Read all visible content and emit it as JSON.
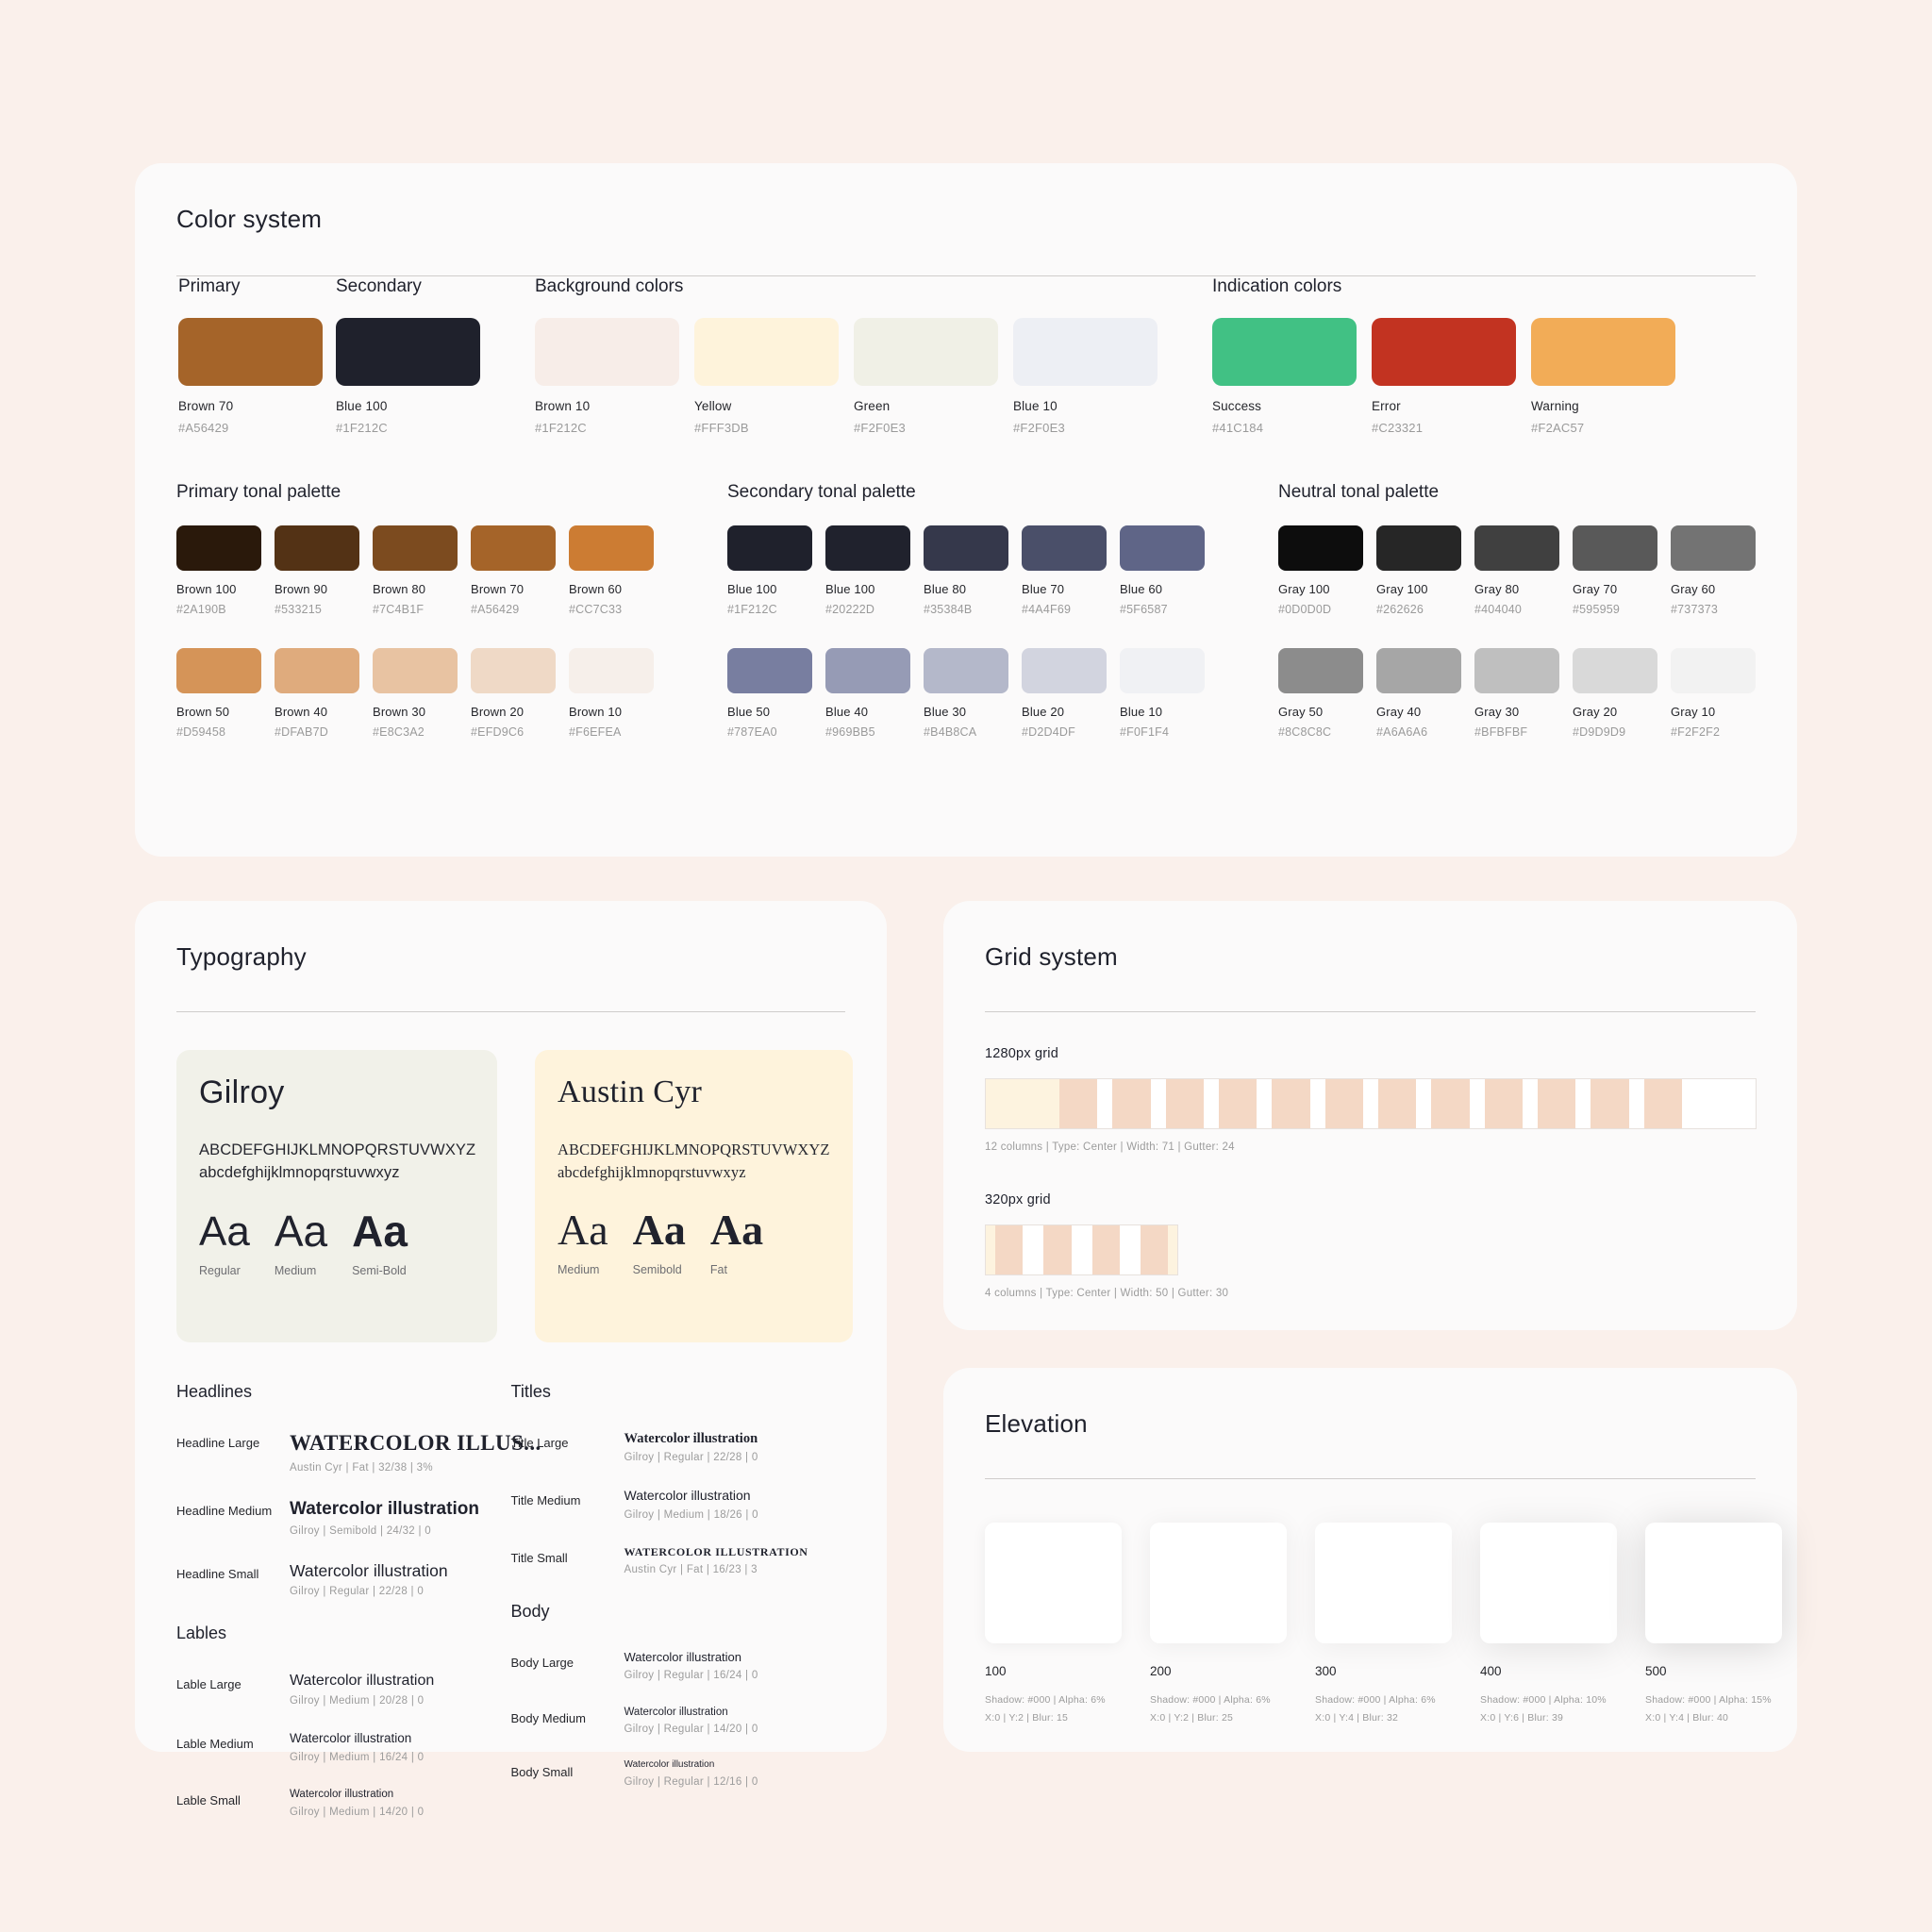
{
  "page": {
    "background": "#FAF0EB"
  },
  "color_system": {
    "title": "Color system",
    "groups": [
      {
        "label": "Primary",
        "swatches": [
          {
            "name": "Brown 70",
            "hex": "#A56429"
          }
        ]
      },
      {
        "label": "Secondary",
        "swatches": [
          {
            "name": "Blue 100",
            "hex": "#1F212C"
          }
        ]
      },
      {
        "label": "Background colors",
        "swatches": [
          {
            "name": "Brown 10",
            "hex": "#1F212C",
            "fill": "#F7EDE8"
          },
          {
            "name": "Yellow",
            "hex": "#FFF3DB",
            "fill": "#FEF3DB"
          },
          {
            "name": "Green",
            "hex": "#F2F0E3",
            "fill": "#F0F0E6"
          },
          {
            "name": "Blue 10",
            "hex": "#F2F0E3",
            "fill": "#EDEFF4"
          }
        ]
      },
      {
        "label": "Indication colors",
        "swatches": [
          {
            "name": "Success",
            "hex": "#41C184"
          },
          {
            "name": "Error",
            "hex": "#C23321"
          },
          {
            "name": "Warning",
            "hex": "#F2AC57"
          }
        ]
      }
    ],
    "tonal_palettes": [
      {
        "title": "Primary tonal palette",
        "rows": [
          [
            {
              "name": "Brown 100",
              "hex": "#2A190B"
            },
            {
              "name": "Brown 90",
              "hex": "#533215"
            },
            {
              "name": "Brown 80",
              "hex": "#7C4B1F"
            },
            {
              "name": "Brown 70",
              "hex": "#A56429"
            },
            {
              "name": "Brown 60",
              "hex": "#CC7C33"
            }
          ],
          [
            {
              "name": "Brown 50",
              "hex": "#D59458"
            },
            {
              "name": "Brown 40",
              "hex": "#DFAB7D"
            },
            {
              "name": "Brown 30",
              "hex": "#E8C3A2"
            },
            {
              "name": "Brown 20",
              "hex": "#EFD9C6"
            },
            {
              "name": "Brown 10",
              "hex": "#F6EFEA"
            }
          ]
        ]
      },
      {
        "title": "Secondary tonal palette",
        "rows": [
          [
            {
              "name": "Blue 100",
              "hex": "#1F212C"
            },
            {
              "name": "Blue 100",
              "hex": "#20222D"
            },
            {
              "name": "Blue 80",
              "hex": "#35384B"
            },
            {
              "name": "Blue 70",
              "hex": "#4A4F69"
            },
            {
              "name": "Blue 60",
              "hex": "#5F6587"
            }
          ],
          [
            {
              "name": "Blue 50",
              "hex": "#787EA0"
            },
            {
              "name": "Blue 40",
              "hex": "#969BB5"
            },
            {
              "name": "Blue 30",
              "hex": "#B4B8CA"
            },
            {
              "name": "Blue 20",
              "hex": "#D2D4DF"
            },
            {
              "name": "Blue 10",
              "hex": "#F0F1F4"
            }
          ]
        ]
      },
      {
        "title": "Neutral tonal palette",
        "rows": [
          [
            {
              "name": "Gray 100",
              "hex": "#0D0D0D"
            },
            {
              "name": "Gray 100",
              "hex": "#262626"
            },
            {
              "name": "Gray 80",
              "hex": "#404040"
            },
            {
              "name": "Gray 70",
              "hex": "#595959"
            },
            {
              "name": "Gray 60",
              "hex": "#737373"
            }
          ],
          [
            {
              "name": "Gray 50",
              "hex": "#8C8C8C"
            },
            {
              "name": "Gray 40",
              "hex": "#A6A6A6"
            },
            {
              "name": "Gray 30",
              "hex": "#BFBFBF"
            },
            {
              "name": "Gray 20",
              "hex": "#D9D9D9"
            },
            {
              "name": "Gray 10",
              "hex": "#F2F2F2"
            }
          ]
        ]
      }
    ]
  },
  "typography": {
    "title": "Typography",
    "specimens": [
      {
        "family": "Gilroy",
        "uppercase": "ABCDEFGHIJKLMNOPQRSTUVWXYZ",
        "lowercase": "abcdefghijklmnopqrstuvwxyz",
        "weights": [
          {
            "glyph": "Aa",
            "name": "Regular"
          },
          {
            "glyph": "Aa",
            "name": "Medium"
          },
          {
            "glyph": "Aa",
            "name": "Semi-Bold"
          }
        ]
      },
      {
        "family": "Austin Cyr",
        "uppercase": "ABCDEFGHIJKLMNOPQRSTUVWXYZ",
        "lowercase": "abcdefghijklmnopqrstuvwxyz",
        "weights": [
          {
            "glyph": "Aa",
            "name": "Medium"
          },
          {
            "glyph": "Aa",
            "name": "Semibold"
          },
          {
            "glyph": "Aa",
            "name": "Fat"
          }
        ]
      }
    ],
    "sections": [
      {
        "heading": "Headlines",
        "rows": [
          {
            "role": "Headline Large",
            "sample": "WATERCOLOR ILLUS...",
            "meta": "Austin Cyr  |  Fat  |  32/38  |  3%"
          },
          {
            "role": "Headline Medium",
            "sample": "Watercolor illustration",
            "meta": "Gilroy  |  Semibold  |  24/32  |  0"
          },
          {
            "role": "Headline Small",
            "sample": "Watercolor illustration",
            "meta": "Gilroy  |  Regular  |  22/28  |  0"
          }
        ]
      },
      {
        "heading": "Titles",
        "rows": [
          {
            "role": "Title Large",
            "sample": "Watercolor illustration",
            "meta": "Gilroy  |  Regular  |  22/28  |  0"
          },
          {
            "role": "Title Medium",
            "sample": "Watercolor illustration",
            "meta": "Gilroy  |  Medium  |  18/26  |  0"
          },
          {
            "role": "Title Small",
            "sample": "WATERCOLOR ILLUSTRATION",
            "meta": "Austin Cyr  |  Fat  |  16/23  |  3"
          }
        ]
      },
      {
        "heading": "Lables",
        "rows": [
          {
            "role": "Lable Large",
            "sample": "Watercolor illustration",
            "meta": "Gilroy  |  Medium  |  20/28  |  0"
          },
          {
            "role": "Lable Medium",
            "sample": "Watercolor illustration",
            "meta": "Gilroy  |  Medium  |  16/24  |  0"
          },
          {
            "role": "Lable Small",
            "sample": "Watercolor illustration",
            "meta": "Gilroy  |  Medium  |  14/20  |  0"
          }
        ]
      },
      {
        "heading": "Body",
        "rows": [
          {
            "role": "Body Large",
            "sample": "Watercolor illustration",
            "meta": "Gilroy  |  Regular  |  16/24  |  0"
          },
          {
            "role": "Body Medium",
            "sample": "Watercolor illustration",
            "meta": "Gilroy  |  Regular  |  14/20  |  0"
          },
          {
            "role": "Body Small",
            "sample": "Watercolor illustration",
            "meta": "Gilroy  |  Regular  |  12/16  |  0"
          }
        ]
      }
    ]
  },
  "grid_system": {
    "title": "Grid system",
    "grids": [
      {
        "label": "1280px grid",
        "columns": 12,
        "meta": "12 columns  |  Type: Center  |  Width: 71  |  Gutter: 24"
      },
      {
        "label": "320px grid",
        "columns": 4,
        "meta": "4 columns  |  Type: Center  |  Width: 50  |  Gutter: 30"
      }
    ],
    "column_color": "#F4D8C5",
    "margin_color": "#FDF3DF"
  },
  "elevation": {
    "title": "Elevation",
    "levels": [
      {
        "name": "100",
        "line1": "Shadow: #000  |  Alpha: 6%",
        "line2": "X:0   |   Y:2   |   Blur: 15"
      },
      {
        "name": "200",
        "line1": "Shadow: #000  |  Alpha: 6%",
        "line2": "X:0   |   Y:2   |   Blur: 25"
      },
      {
        "name": "300",
        "line1": "Shadow: #000  |  Alpha: 6%",
        "line2": "X:0   |   Y:4   |   Blur: 32"
      },
      {
        "name": "400",
        "line1": "Shadow: #000  |  Alpha: 10%",
        "line2": "X:0   |   Y:6   |   Blur: 39"
      },
      {
        "name": "500",
        "line1": "Shadow: #000  |  Alpha: 15%",
        "line2": "X:0   |   Y:4   |   Blur: 40"
      }
    ]
  }
}
